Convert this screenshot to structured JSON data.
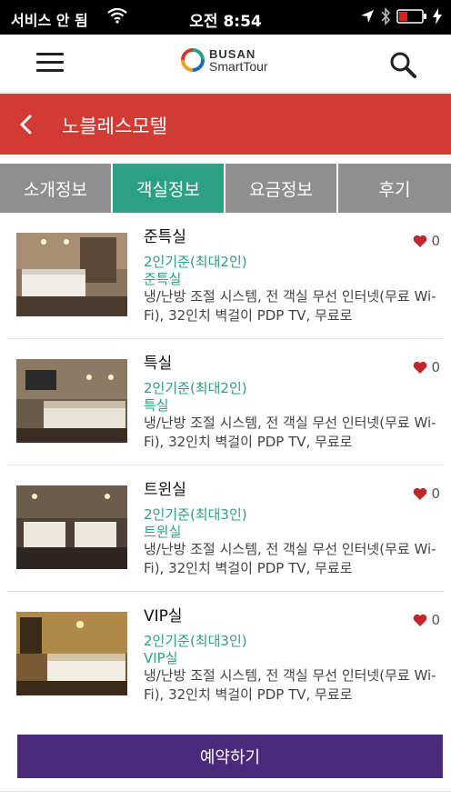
{
  "status_bar": {
    "carrier": "서비스 안 됨",
    "time": "오전 8:54",
    "icons": [
      "wifi-icon",
      "location-arrow-icon",
      "bluetooth-icon",
      "battery-low-icon",
      "charging-bolt-icon"
    ],
    "battery_color": "#e02020"
  },
  "header": {
    "logo_line1": "BUSAN",
    "logo_line2": "SmartTour",
    "menu_icon": "hamburger-menu-icon",
    "search_icon": "search-icon"
  },
  "title_bar": {
    "title": "노블레스모텔",
    "color": "#d23a34"
  },
  "tabs": [
    {
      "label": "소개정보",
      "active": false
    },
    {
      "label": "객실정보",
      "active": true
    },
    {
      "label": "요금정보",
      "active": false
    },
    {
      "label": "후기",
      "active": false
    }
  ],
  "rooms": [
    {
      "name": "준특실",
      "capacity": "2인기준(최대2인)",
      "type": "준특실",
      "description": "냉/난방 조절 시스템, 전 객실 무선 인터넷(무료 Wi-Fi), 32인치 벽걸이 PDP TV, 무료로",
      "likes": "0"
    },
    {
      "name": "특실",
      "capacity": "2인기준(최대2인)",
      "type": "특실",
      "description": "냉/난방 조절 시스템, 전 객실 무선 인터넷(무료 Wi-Fi), 32인치 벽걸이 PDP TV, 무료로",
      "likes": "0"
    },
    {
      "name": "트윈실",
      "capacity": "2인기준(최대3인)",
      "type": "트윈실",
      "description": "냉/난방 조절 시스템, 전 객실 무선 인터넷(무료 Wi-Fi), 32인치 벽걸이 PDP TV, 무료로",
      "likes": "0"
    },
    {
      "name": "VIP실",
      "capacity": "2인기준(최대3인)",
      "type": "VIP실",
      "description": "냉/난방 조절 시스템, 전 객실 무선 인터넷(무료 Wi-Fi), 32인치 벽걸이 PDP TV, 무료로",
      "likes": "0"
    }
  ],
  "reserve_button": {
    "label": "예약하기",
    "color": "#4a2a7a"
  },
  "colors": {
    "accent_green": "#2aa085",
    "tab_inactive": "#8f8f8f",
    "heart": "#c0262e"
  }
}
